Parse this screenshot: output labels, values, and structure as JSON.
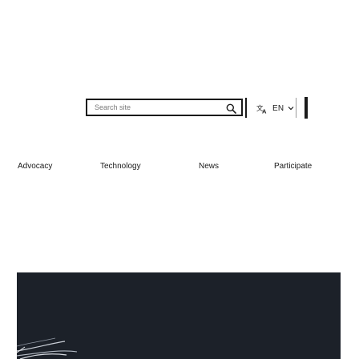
{
  "header": {
    "search": {
      "placeholder": "Search site",
      "value": "",
      "icon": "search-icon"
    },
    "language": {
      "icon": "translate-icon",
      "label": "EN",
      "dropdown_icon": "chevron-down-icon"
    },
    "menu_icon": "menu-bar-icon"
  },
  "nav": {
    "items": [
      {
        "label": "Advocacy"
      },
      {
        "label": "Technology"
      },
      {
        "label": "News"
      },
      {
        "label": "Participate"
      }
    ]
  },
  "hero": {
    "image": "abstract-lines-image"
  },
  "colors": {
    "text": "#1a1a1a",
    "hero_bg": "#1c2129",
    "hero_lines": "#c9ced6"
  }
}
